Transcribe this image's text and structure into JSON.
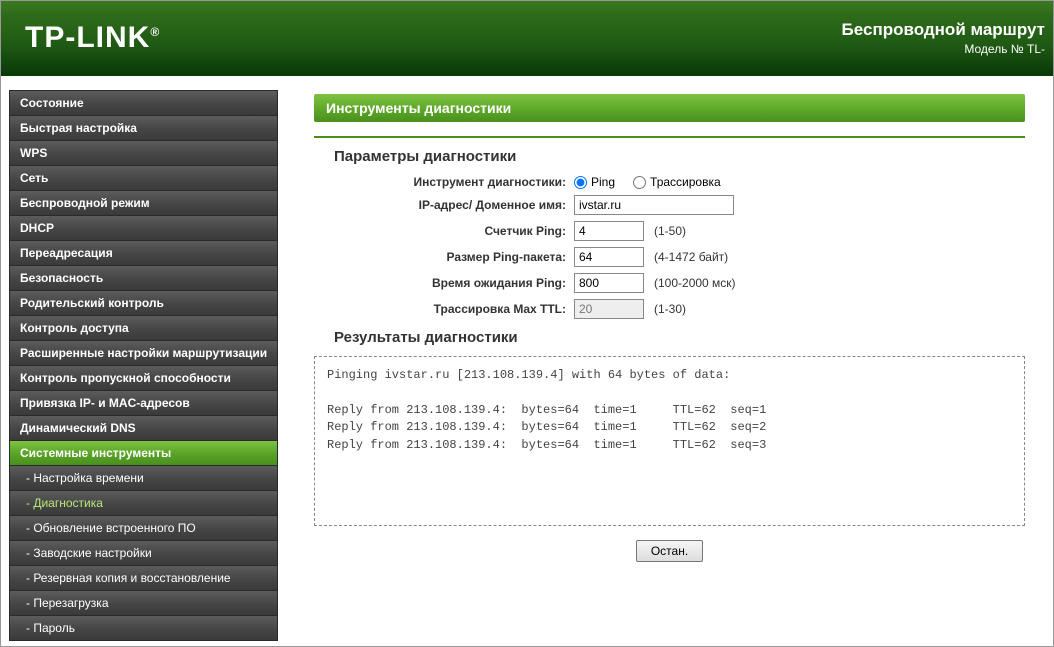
{
  "header": {
    "brand": "TP-LINK",
    "reg": "®",
    "title": "Беспроводной маршрут",
    "model": "Модель № TL-"
  },
  "sidebar": {
    "items": [
      {
        "label": "Состояние",
        "sub": false
      },
      {
        "label": "Быстрая настройка",
        "sub": false
      },
      {
        "label": "WPS",
        "sub": false
      },
      {
        "label": "Сеть",
        "sub": false
      },
      {
        "label": "Беспроводной режим",
        "sub": false
      },
      {
        "label": "DHCP",
        "sub": false
      },
      {
        "label": "Переадресация",
        "sub": false
      },
      {
        "label": "Безопасность",
        "sub": false
      },
      {
        "label": "Родительский контроль",
        "sub": false
      },
      {
        "label": "Контроль доступа",
        "sub": false
      },
      {
        "label": "Расширенные настройки маршрутизации",
        "sub": false
      },
      {
        "label": "Контроль пропускной способности",
        "sub": false
      },
      {
        "label": "Привязка IP- и MAC-адресов",
        "sub": false
      },
      {
        "label": "Динамический DNS",
        "sub": false
      },
      {
        "label": "Системные инструменты",
        "sub": false,
        "active": true
      },
      {
        "label": "- Настройка времени",
        "sub": true
      },
      {
        "label": "- Диагностика",
        "sub": true,
        "current": true
      },
      {
        "label": "- Обновление встроенного ПО",
        "sub": true
      },
      {
        "label": "- Заводские настройки",
        "sub": true
      },
      {
        "label": "- Резервная копия и восстановление",
        "sub": true
      },
      {
        "label": "- Перезагрузка",
        "sub": true
      },
      {
        "label": "- Пароль",
        "sub": true
      }
    ]
  },
  "main": {
    "page_title": "Инструменты диагностики",
    "section_params": "Параметры диагностики",
    "section_results": "Результаты диагностики",
    "form": {
      "tool_label": "Инструмент диагностики:",
      "tool_ping": "Ping",
      "tool_trace": "Трассировка",
      "ip_label": "IP-адрес/ Доменное имя:",
      "ip_value": "ivstar.ru",
      "count_label": "Счетчик Ping:",
      "count_value": "4",
      "count_hint": "(1-50)",
      "size_label": "Размер Ping-пакета:",
      "size_value": "64",
      "size_hint": "(4-1472 байт)",
      "timeout_label": "Время ожидания Ping:",
      "timeout_value": "800",
      "timeout_hint": "(100-2000 мск)",
      "ttl_label": "Трассировка Max TTL:",
      "ttl_value": "20",
      "ttl_hint": "(1-30)"
    },
    "results_text": "Pinging ivstar.ru [213.108.139.4] with 64 bytes of data:\n\nReply from 213.108.139.4:  bytes=64  time=1     TTL=62  seq=1\nReply from 213.108.139.4:  bytes=64  time=1     TTL=62  seq=2\nReply from 213.108.139.4:  bytes=64  time=1     TTL=62  seq=3",
    "stop_button": "Остан."
  }
}
